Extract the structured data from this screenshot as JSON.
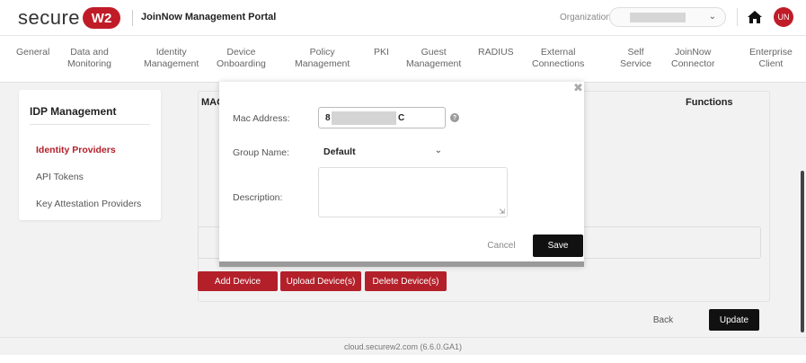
{
  "header": {
    "logo_text": "secure",
    "logo_badge": "W2",
    "portal_title": "JoinNow Management Portal",
    "org_label": "Organization :",
    "avatar_initials": "UN",
    "brand_color": "#c01c28"
  },
  "nav": {
    "items": [
      {
        "line1": "General",
        "line2": ""
      },
      {
        "line1": "Data and",
        "line2": "Monitoring"
      },
      {
        "line1": "Identity",
        "line2": "Management"
      },
      {
        "line1": "Device",
        "line2": "Onboarding"
      },
      {
        "line1": "Policy",
        "line2": "Management"
      },
      {
        "line1": "PKI",
        "line2": ""
      },
      {
        "line1": "Guest",
        "line2": "Management"
      },
      {
        "line1": "RADIUS",
        "line2": ""
      },
      {
        "line1": "External",
        "line2": "Connections"
      },
      {
        "line1": "Self",
        "line2": "Service"
      },
      {
        "line1": "JoinNow",
        "line2": "Connector"
      },
      {
        "line1": "Enterprise",
        "line2": "Client"
      }
    ]
  },
  "sidebar": {
    "title": "IDP Management",
    "links": [
      {
        "label": "Identity Providers",
        "active": true
      },
      {
        "label": "API Tokens",
        "active": false
      },
      {
        "label": "Key Attestation Providers",
        "active": false
      }
    ]
  },
  "table": {
    "col_mac": "MAC",
    "col_functions": "Functions"
  },
  "actions": {
    "add_device": "Add Device",
    "upload_devices": "Upload Device(s)",
    "delete_devices": "Delete Device(s)",
    "back": "Back",
    "update": "Update"
  },
  "modal": {
    "close_glyph": "✖",
    "mac_label": "Mac Address:",
    "mac_value_start": "8",
    "mac_value_end": "C",
    "group_label": "Group Name:",
    "group_value": "Default",
    "description_label": "Description:",
    "description_value": "",
    "cancel": "Cancel",
    "save": "Save"
  },
  "footer": {
    "text": "cloud.securew2.com (6.6.0.GA1)"
  }
}
